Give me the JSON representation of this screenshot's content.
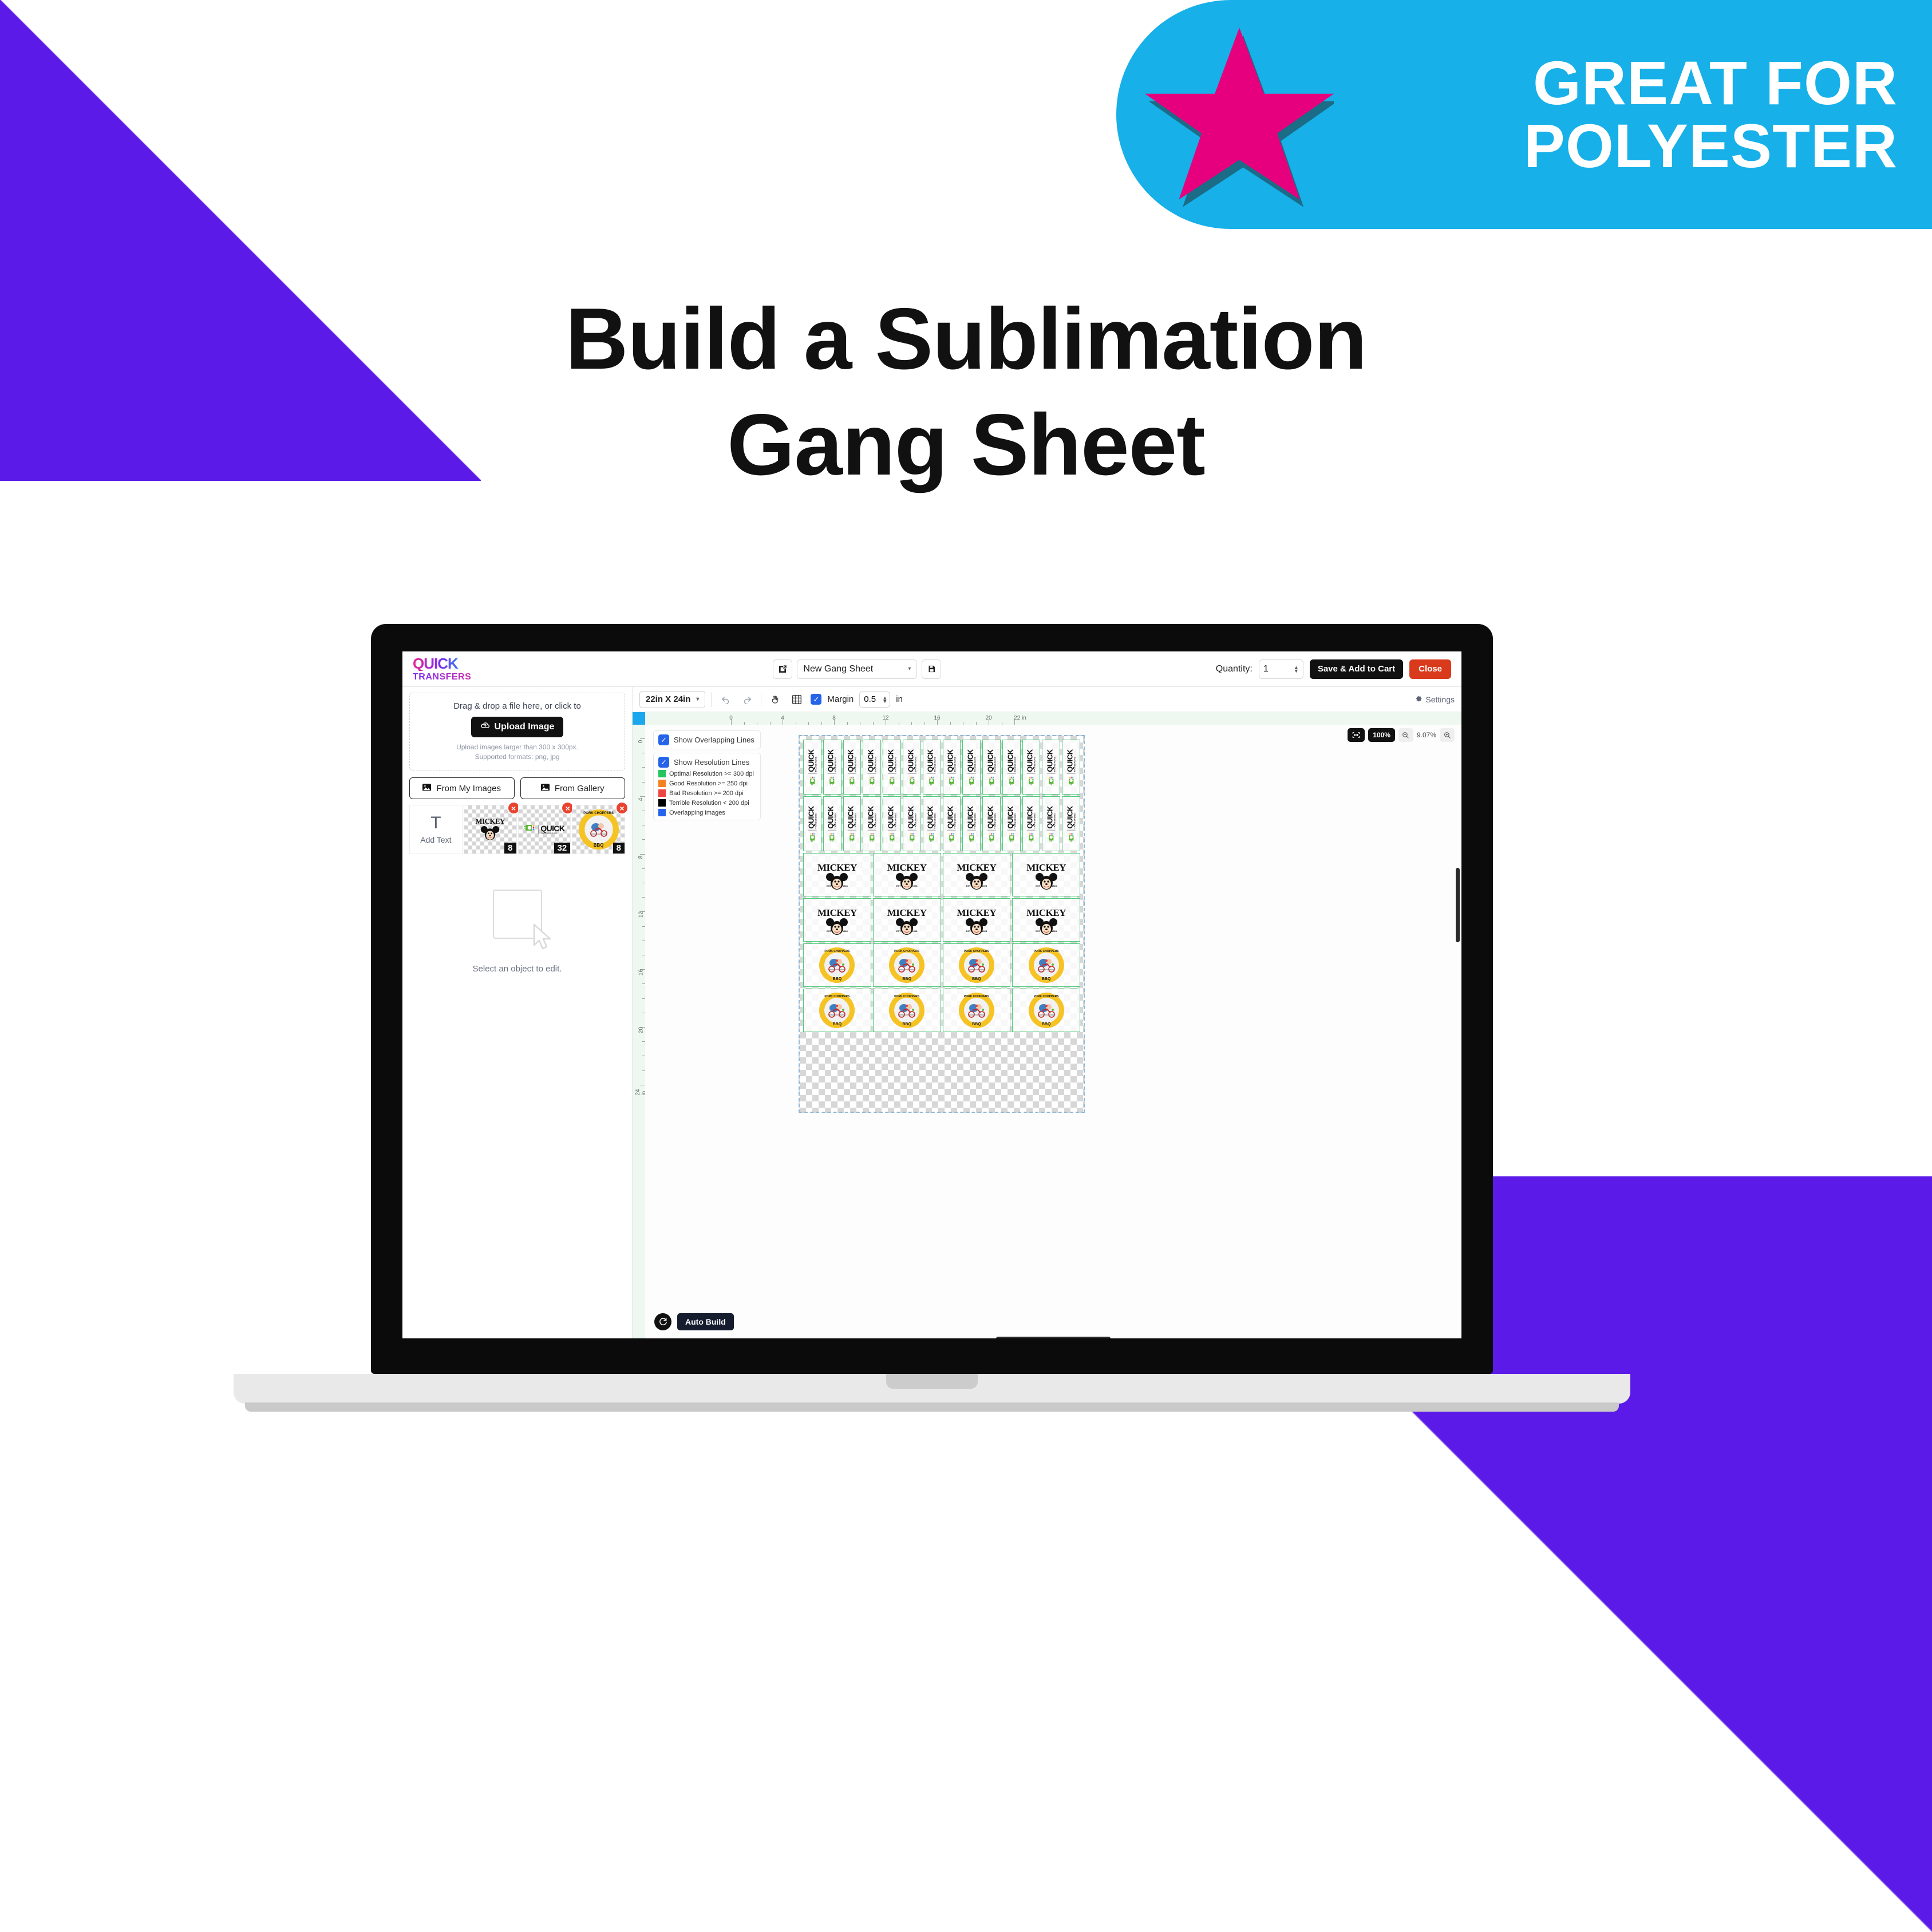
{
  "decor": {
    "purple": "#5B1AE8",
    "badge_bg": "#17B0E8",
    "star_color": "#E6007E"
  },
  "badge": {
    "line1": "GREAT FOR",
    "line2": "POLYESTER",
    "star_icon": "star-icon"
  },
  "title": {
    "line1": "Build a Sublimation",
    "line2": "Gang Sheet"
  },
  "app": {
    "brand": {
      "line1": "QUICK",
      "line2": "TRANSFERS"
    },
    "topbar": {
      "edit_icon": "edit-square-icon",
      "sheet_name": "New Gang Sheet",
      "chevron": "▾",
      "save_icon": "save-disk-icon",
      "quantity_label": "Quantity:",
      "quantity_value": "1",
      "save_cart_label": "Save & Add to Cart",
      "close_label": "Close"
    },
    "left_panel": {
      "drop_title": "Drag & drop a file here, or click to",
      "upload_label": "Upload Image",
      "upload_icon": "cloud-upload-icon",
      "note1": "Upload images larger than 300 x 300px.",
      "note2": "Supported formats: png, jpg",
      "from_my_images": "From My Images",
      "from_gallery": "From Gallery",
      "image_icon": "image-icon",
      "thumbs": [
        {
          "kind": "add-text",
          "glyph": "T",
          "label": "Add Text"
        },
        {
          "kind": "mickey",
          "count": "8",
          "remove": "×"
        },
        {
          "kind": "quick",
          "count": "32",
          "remove": "×"
        },
        {
          "kind": "bbq",
          "count": "8",
          "remove": "×"
        }
      ],
      "select_note": "Select an object to edit.",
      "cursor_icon": "cursor-arrow-icon"
    },
    "toolbar": {
      "sheet_size": "22in X 24in",
      "chevron": "▾",
      "undo_icon": "undo-icon",
      "redo_icon": "redo-icon",
      "hand_icon": "hand-icon",
      "grid_icon": "grid-icon",
      "margin_checked": true,
      "margin_label": "Margin",
      "margin_value": "0.5",
      "margin_unit": "in",
      "settings_label": "Settings",
      "settings_icon": "gear-icon"
    },
    "rulers": {
      "unit": "in",
      "horizontal_labels": [
        "0",
        "4",
        "8",
        "12",
        "16",
        "20",
        "22 in"
      ],
      "vertical_labels": [
        "0",
        "4",
        "8",
        "12",
        "16",
        "20",
        "24 in"
      ]
    },
    "legend": {
      "overlapping_title": "Show Overlapping Lines",
      "overlapping_checked": true,
      "resolution_title": "Show Resolution Lines",
      "resolution_checked": true,
      "items": [
        {
          "color": "#22C55E",
          "label": "Optimal Resolution >= 300 dpi"
        },
        {
          "color": "#F58220",
          "label": "Good Resolution >= 250 dpi"
        },
        {
          "color": "#EF4444",
          "label": "Bad Resolution >= 200 dpi"
        },
        {
          "color": "#000000",
          "label": "Terrible Resolution < 200 dpi"
        },
        {
          "color": "#2563EB",
          "label": "Overlapping images"
        }
      ]
    },
    "zoom_controls": {
      "fit_icon": "fit-screen-icon",
      "preset": "100%",
      "zoom_out_icon": "zoom-out-icon",
      "value": "9.07%",
      "zoom_in_icon": "zoom-in-icon"
    },
    "bottom": {
      "refresh_icon": "refresh-icon",
      "auto_build_label": "Auto Build"
    },
    "artwork": {
      "quick": {
        "name": "QUICK TRANSFERS",
        "word": "QUICK",
        "sub": "TRANSFERS",
        "columns": 14,
        "rows": 2,
        "total": 28
      },
      "mickey": {
        "name": "MICKEY",
        "word": "MICKEY",
        "est_left": "EST",
        "est_right": "1928",
        "columns": 4,
        "rows": 2,
        "total": 8
      },
      "bbq": {
        "name": "PORK CHOPPERS BBQ",
        "top_text": "PORK CHOPPERS",
        "bottom_text": "BBQ",
        "columns": 4,
        "rows": 2,
        "total": 8
      }
    }
  }
}
